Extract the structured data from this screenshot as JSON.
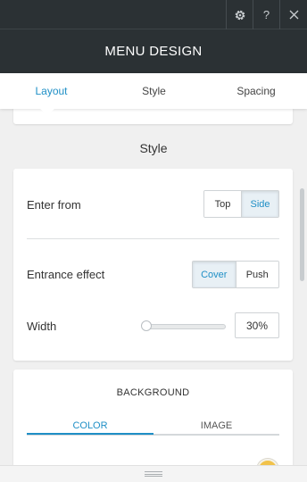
{
  "window": {
    "settings_icon": "gear-icon",
    "help_label": "?",
    "close_icon": "close-icon"
  },
  "header": {
    "title": "MENU DESIGN"
  },
  "tabs": [
    {
      "label": "Layout",
      "active": true
    },
    {
      "label": "Style",
      "active": false
    },
    {
      "label": "Spacing",
      "active": false
    }
  ],
  "style_section": {
    "heading": "Style",
    "enter_from": {
      "label": "Enter from",
      "options": [
        "Top",
        "Side"
      ],
      "selected": "Side"
    },
    "entrance_effect": {
      "label": "Entrance effect",
      "options": [
        "Cover",
        "Push"
      ],
      "selected": "Cover"
    },
    "width": {
      "label": "Width",
      "value": "30%",
      "slider_fraction": 0.0
    }
  },
  "background": {
    "heading": "BACKGROUND",
    "tabs": [
      "COLOR",
      "IMAGE"
    ],
    "active_tab": "COLOR",
    "color": "#f1c24a"
  },
  "colors": {
    "accent": "#1f8fc6",
    "header_bg": "#2b3134"
  }
}
